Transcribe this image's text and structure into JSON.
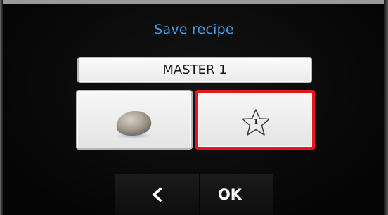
{
  "dialog": {
    "title": "Save recipe",
    "recipe_name": "MASTER 1"
  },
  "tiles": {
    "image_icon": "stone-icon",
    "favorite_icon": "star-icon",
    "favorite_number": "1",
    "favorite_selected": true
  },
  "buttons": {
    "back_icon": "chevron-left-icon",
    "ok_label": "OK"
  },
  "colors": {
    "title": "#3fa0e8",
    "selection": "#e8141e",
    "background": "#0a0a0a"
  }
}
